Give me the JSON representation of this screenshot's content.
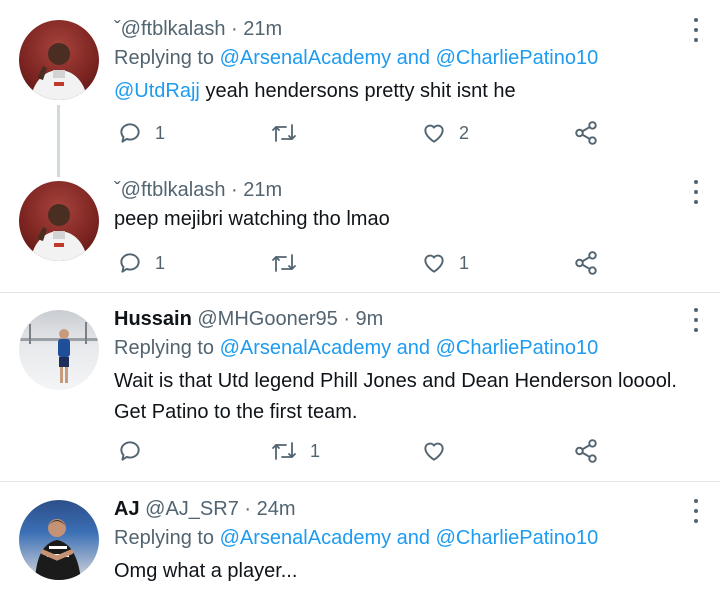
{
  "colors": {
    "accent": "#1d9bf0",
    "muted": "#536471",
    "text": "#0f1419"
  },
  "tweets": [
    {
      "handle": "ˇ@ftblkalash",
      "time": "21m",
      "reply_prefix": "Replying to",
      "reply_to_1": "@ArsenalAcademy",
      "reply_join": "and",
      "reply_to_2": "@CharliePatino10",
      "mention": "@UtdRajj",
      "text": "yeah hendersons pretty shit isnt he",
      "reply_count": "1",
      "retweet_count": "",
      "like_count": "2"
    },
    {
      "handle": "ˇ@ftblkalash",
      "time": "21m",
      "text": "peep mejibri watching tho lmao",
      "reply_count": "1",
      "retweet_count": "",
      "like_count": "1"
    },
    {
      "name": "Hussain",
      "handle": "@MHGooner95",
      "time": "9m",
      "reply_prefix": "Replying to",
      "reply_to_1": "@ArsenalAcademy",
      "reply_join": "and",
      "reply_to_2": "@CharliePatino10",
      "text_line1": "Wait is that Utd legend Phill Jones and Dean Henderson looool.",
      "text_line2": "Get Patino to the first team.",
      "reply_count": "",
      "retweet_count": "1",
      "like_count": ""
    },
    {
      "name": "AJ",
      "handle": "@AJ_SR7",
      "time": "24m",
      "reply_prefix": "Replying to",
      "reply_to_1": "@ArsenalAcademy",
      "reply_join": "and",
      "reply_to_2": "@CharliePatino10",
      "text": "Omg what a player..."
    }
  ],
  "icons": {
    "reply": "reply-icon",
    "retweet": "retweet-icon",
    "like": "heart-icon",
    "share": "share-icon",
    "more": "more-vertical-icon"
  }
}
